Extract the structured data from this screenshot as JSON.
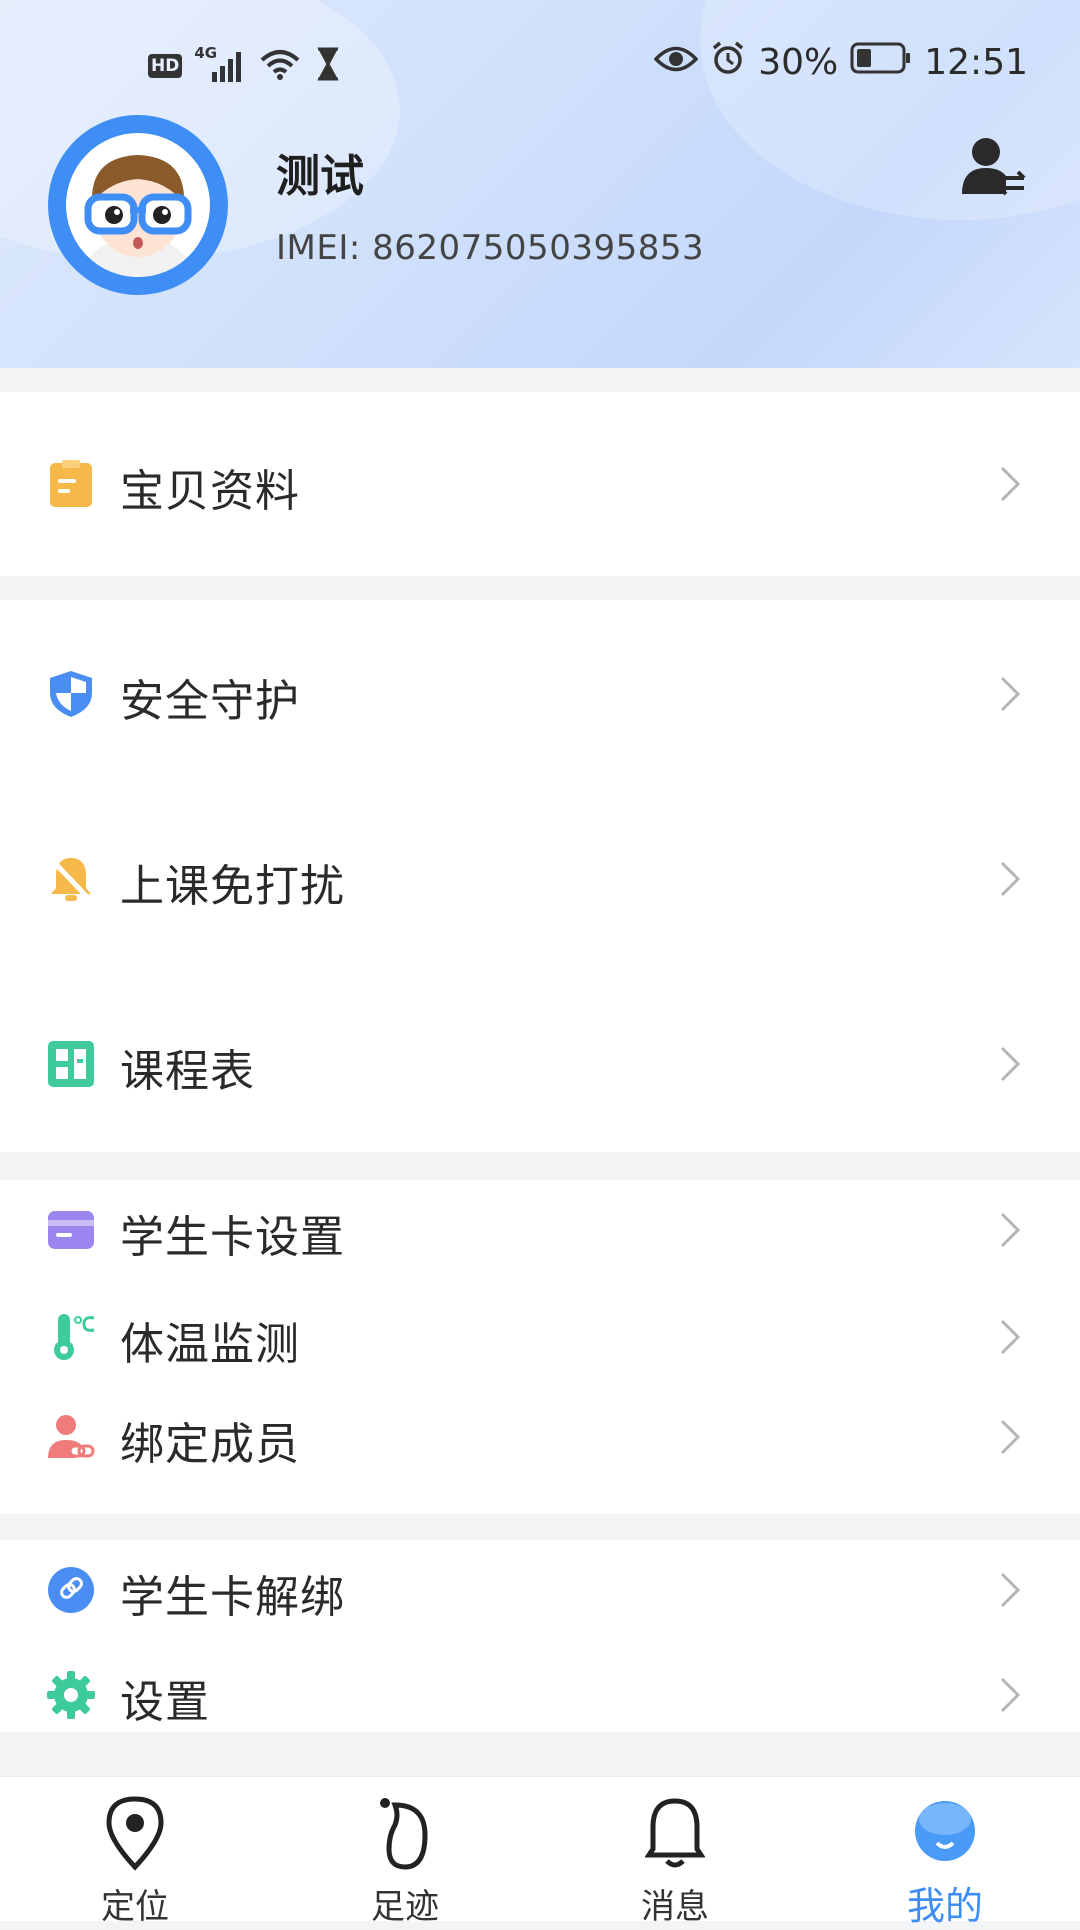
{
  "status_bar": {
    "network_badge": "HD",
    "signal_label": "4G",
    "battery": "30%",
    "time": "12:51"
  },
  "profile": {
    "name": "测试",
    "imei": "IMEI: 862075050395853"
  },
  "menu": {
    "baby_info": "宝贝资料",
    "safety_guard": "安全守护",
    "class_dnd": "上课免打扰",
    "timetable": "课程表",
    "student_card_settings": "学生卡设置",
    "temperature": "体温监测",
    "bind_members": "绑定成员",
    "unbind_card": "学生卡解绑",
    "settings": "设置"
  },
  "tabs": [
    {
      "label": "定位",
      "icon": "location-pin-icon",
      "active": false
    },
    {
      "label": "足迹",
      "icon": "footprint-icon",
      "active": false
    },
    {
      "label": "消息",
      "icon": "bell-icon",
      "active": false
    },
    {
      "label": "我的",
      "icon": "profile-face-icon",
      "active": true
    }
  ],
  "colors": {
    "accent": "#3f8ef5",
    "header_bg": "#cfe0fb",
    "page_bg": "#f3f4f6"
  }
}
